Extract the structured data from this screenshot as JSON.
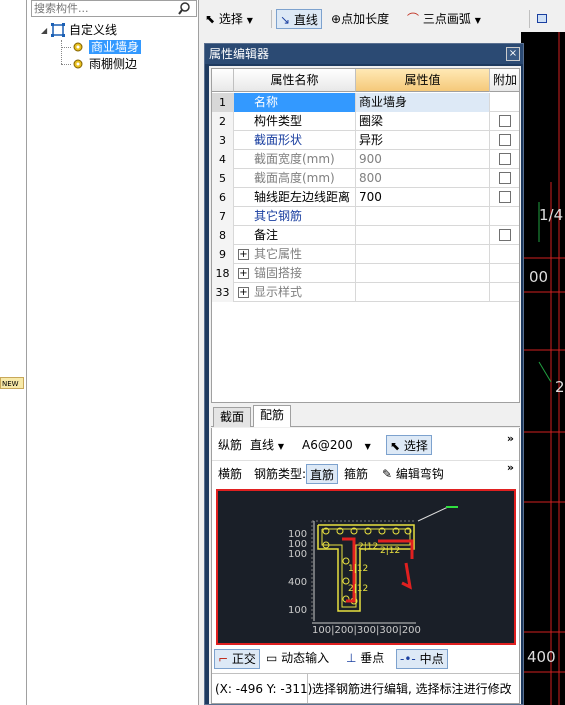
{
  "search": {
    "placeholder": "搜索构件..."
  },
  "tree": {
    "root": "自定义线",
    "children": [
      "商业墙身",
      "雨棚侧边"
    ]
  },
  "left_strip": {
    "badge": "NEW"
  },
  "toolbar": {
    "select": "选择",
    "line": "直线",
    "point_length": "点加长度",
    "three_point_arc": "三点画弧"
  },
  "cad_labels": [
    "1/4",
    "00",
    "2",
    "400"
  ],
  "dialog": {
    "title": "属性编辑器",
    "close": "×",
    "columns": [
      "属性名称",
      "属性值",
      "附加"
    ],
    "rows": [
      {
        "num": "1",
        "name": "名称",
        "value": "商业墙身",
        "checkbox": false,
        "expander": false,
        "style": "blue"
      },
      {
        "num": "2",
        "name": "构件类型",
        "value": "圈梁",
        "checkbox": true,
        "expander": false,
        "style": ""
      },
      {
        "num": "3",
        "name": "截面形状",
        "value": "异形",
        "checkbox": true,
        "expander": false,
        "style": "blue"
      },
      {
        "num": "4",
        "name": "截面宽度(mm)",
        "value": "900",
        "checkbox": true,
        "expander": false,
        "style": "gray"
      },
      {
        "num": "5",
        "name": "截面高度(mm)",
        "value": "800",
        "checkbox": true,
        "expander": false,
        "style": "gray"
      },
      {
        "num": "6",
        "name": "轴线距左边线距离",
        "value": "700",
        "checkbox": true,
        "expander": false,
        "style": ""
      },
      {
        "num": "7",
        "name": "其它钢筋",
        "value": "",
        "checkbox": false,
        "expander": false,
        "style": "blue"
      },
      {
        "num": "8",
        "name": "备注",
        "value": "",
        "checkbox": true,
        "expander": false,
        "style": ""
      },
      {
        "num": "9",
        "name": "其它属性",
        "value": "",
        "checkbox": false,
        "expander": true,
        "style": "gray"
      },
      {
        "num": "18",
        "name": "锚固搭接",
        "value": "",
        "checkbox": false,
        "expander": true,
        "style": "gray"
      },
      {
        "num": "33",
        "name": "显示样式",
        "value": "",
        "checkbox": false,
        "expander": true,
        "style": "gray"
      }
    ],
    "tabs": [
      "截面",
      "配筋"
    ],
    "rebar": {
      "longitudinal_label": "纵筋",
      "line_mode": "直线",
      "spec": "A6@200",
      "select_label": "选择",
      "transverse_label": "横筋",
      "type_label": "钢筋类型:",
      "type_straight": "直筋",
      "type_stirrup": "箍筋",
      "edit_hook": "编辑弯钩",
      "more": "»"
    },
    "preview_dims": {
      "left": [
        "100",
        "100",
        "100",
        "400",
        "100"
      ],
      "bottom": "100|200|300|300|200",
      "inner": [
        "2|12",
        "2|12",
        "1|12",
        "2|12"
      ]
    },
    "snap": {
      "ortho": "正交",
      "dynamic_input": "动态输入",
      "perpendicular": "垂点",
      "midpoint": "中点"
    },
    "status": {
      "coord": "(X: -496 Y: -311)",
      "message": "选择钢筋进行编辑, 选择标注进行修改"
    }
  }
}
